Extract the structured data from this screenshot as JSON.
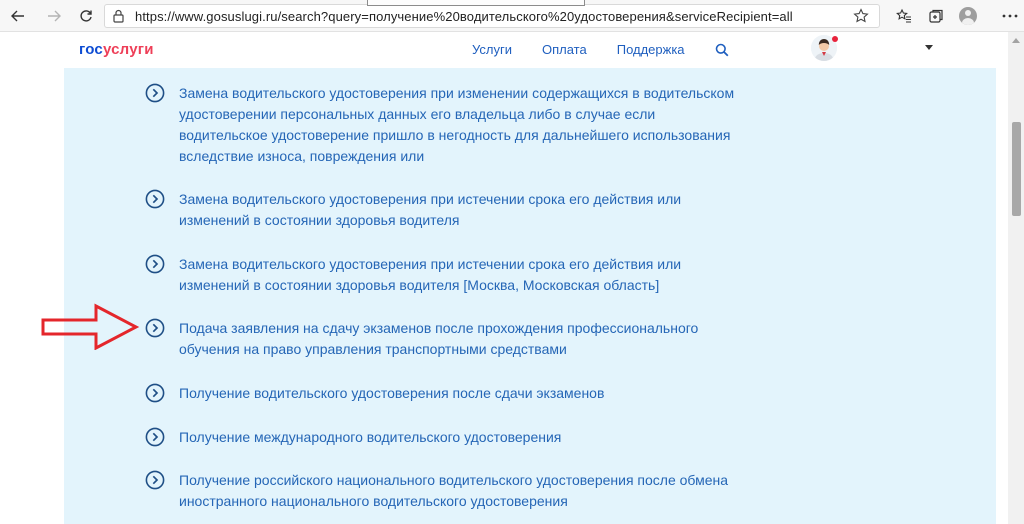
{
  "browser": {
    "url": "https://www.gosuslugi.ru/search?query=получение%20водительского%20удостоверения&serviceRecipient=all",
    "icons": [
      "back-icon",
      "forward-icon",
      "refresh-icon",
      "lock-icon",
      "star-icon",
      "favorites-icon",
      "collections-icon",
      "profile-icon",
      "menu-icon"
    ]
  },
  "site": {
    "logo_part1": "гос",
    "logo_part2": "услуги",
    "nav": [
      "Услуги",
      "Оплата",
      "Поддержка"
    ],
    "colors": {
      "logo_blue": "#0d4cd3",
      "logo_red": "#ee3f58",
      "link": "#2566b6",
      "panel": "#e3f4fc",
      "arrow": "#e4262b"
    }
  },
  "results": [
    {
      "text": "Замена водительского удостоверения при изменении содержащихся в водительском удостоверении персональных данных его владельца либо в случае если водительское удостоверение пришло в негодность для дальнейшего использования вследствие износа, повреждения или"
    },
    {
      "text": "Замена водительского удостоверения при истечении срока его действия или изменений в состоянии здоровья водителя"
    },
    {
      "text": "Замена водительского удостоверения при истечении срока его действия или изменений в состоянии здоровья водителя [Москва, Московская область]"
    },
    {
      "text": "Подача заявления на сдачу экзаменов после прохождения профессионального обучения на право управления транспортными средствами"
    },
    {
      "text": "Получение водительского удостоверения после сдачи экзаменов"
    },
    {
      "text": "Получение международного водительского удостоверения"
    },
    {
      "text": "Получение российского национального водительского удостоверения после обмена иностранного национального водительского удостоверения"
    }
  ]
}
